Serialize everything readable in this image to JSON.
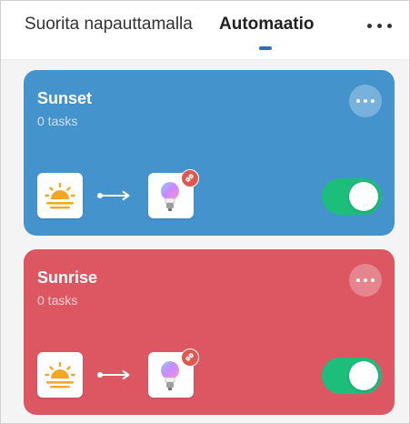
{
  "header": {
    "tabs": [
      {
        "label": "Suorita napauttamalla",
        "active": false
      },
      {
        "label": "Automaatio",
        "active": true
      }
    ],
    "more_icon": "more-horizontal-icon"
  },
  "automations": [
    {
      "name": "Sunset",
      "tasks_label": "0 tasks",
      "color": "#4593cd",
      "trigger_icon": "sunset-icon",
      "action_icon": "smart-bulb-icon",
      "badge_icon": "link-icon",
      "enabled": true
    },
    {
      "name": "Sunrise",
      "tasks_label": "0 tasks",
      "color": "#dc5762",
      "trigger_icon": "sunrise-icon",
      "action_icon": "smart-bulb-icon",
      "badge_icon": "link-icon",
      "enabled": true
    }
  ],
  "colors": {
    "toggle_on": "#1dbd7c",
    "tab_indicator": "#2d6fb8",
    "trigger_sun": "#f5a623",
    "link_badge": "#e2564f"
  }
}
